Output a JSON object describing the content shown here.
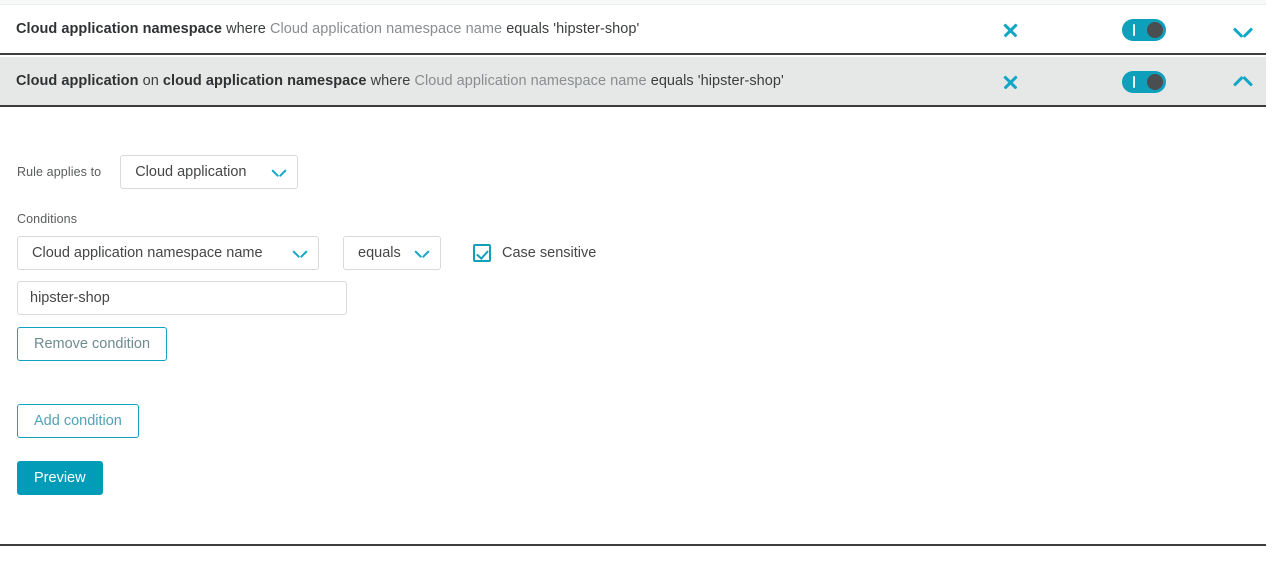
{
  "theme": {
    "accent": "#029cb8",
    "accent_light": "#10a7c6",
    "row_gray": "#e6e7e7",
    "divider_dark": "#3b3d3e",
    "text": "#454646",
    "text_muted": "#898d8f"
  },
  "rules": [
    {
      "summary": {
        "subject": "Cloud application namespace",
        "where": "where",
        "attribute": "Cloud application namespace name",
        "operator_phrase": "equals 'hipster-shop'"
      },
      "close_icon": "close-icon",
      "toggle": {
        "state": "on",
        "icon": "toggle-switch-on"
      },
      "caret": {
        "direction": "down",
        "icon": "chevron-down-icon"
      },
      "expanded": false
    },
    {
      "summary": {
        "subject": "Cloud application",
        "on": "on",
        "relation": "cloud application namespace",
        "where": "where",
        "attribute": "Cloud application namespace name",
        "operator_phrase": "equals 'hipster-shop'"
      },
      "close_icon": "close-icon",
      "toggle": {
        "state": "on",
        "icon": "toggle-switch-on"
      },
      "caret": {
        "direction": "up",
        "icon": "chevron-up-icon"
      },
      "expanded": true
    }
  ],
  "form": {
    "rule_applies_to": {
      "label": "Rule applies to",
      "value": "Cloud application",
      "caret_icon": "chevron-down-icon"
    },
    "conditions_label": "Conditions",
    "condition": {
      "attribute": {
        "value": "Cloud application namespace name",
        "caret_icon": "chevron-down-icon"
      },
      "operator": {
        "value": "equals",
        "caret_icon": "chevron-down-icon"
      },
      "case_sensitive": {
        "label": "Case sensitive",
        "checked": true,
        "icon": "checkmark-icon"
      },
      "value_input": {
        "value": "hipster-shop",
        "placeholder": ""
      },
      "remove_button": "Remove condition"
    },
    "add_condition_button": "Add condition",
    "preview_button": "Preview"
  }
}
